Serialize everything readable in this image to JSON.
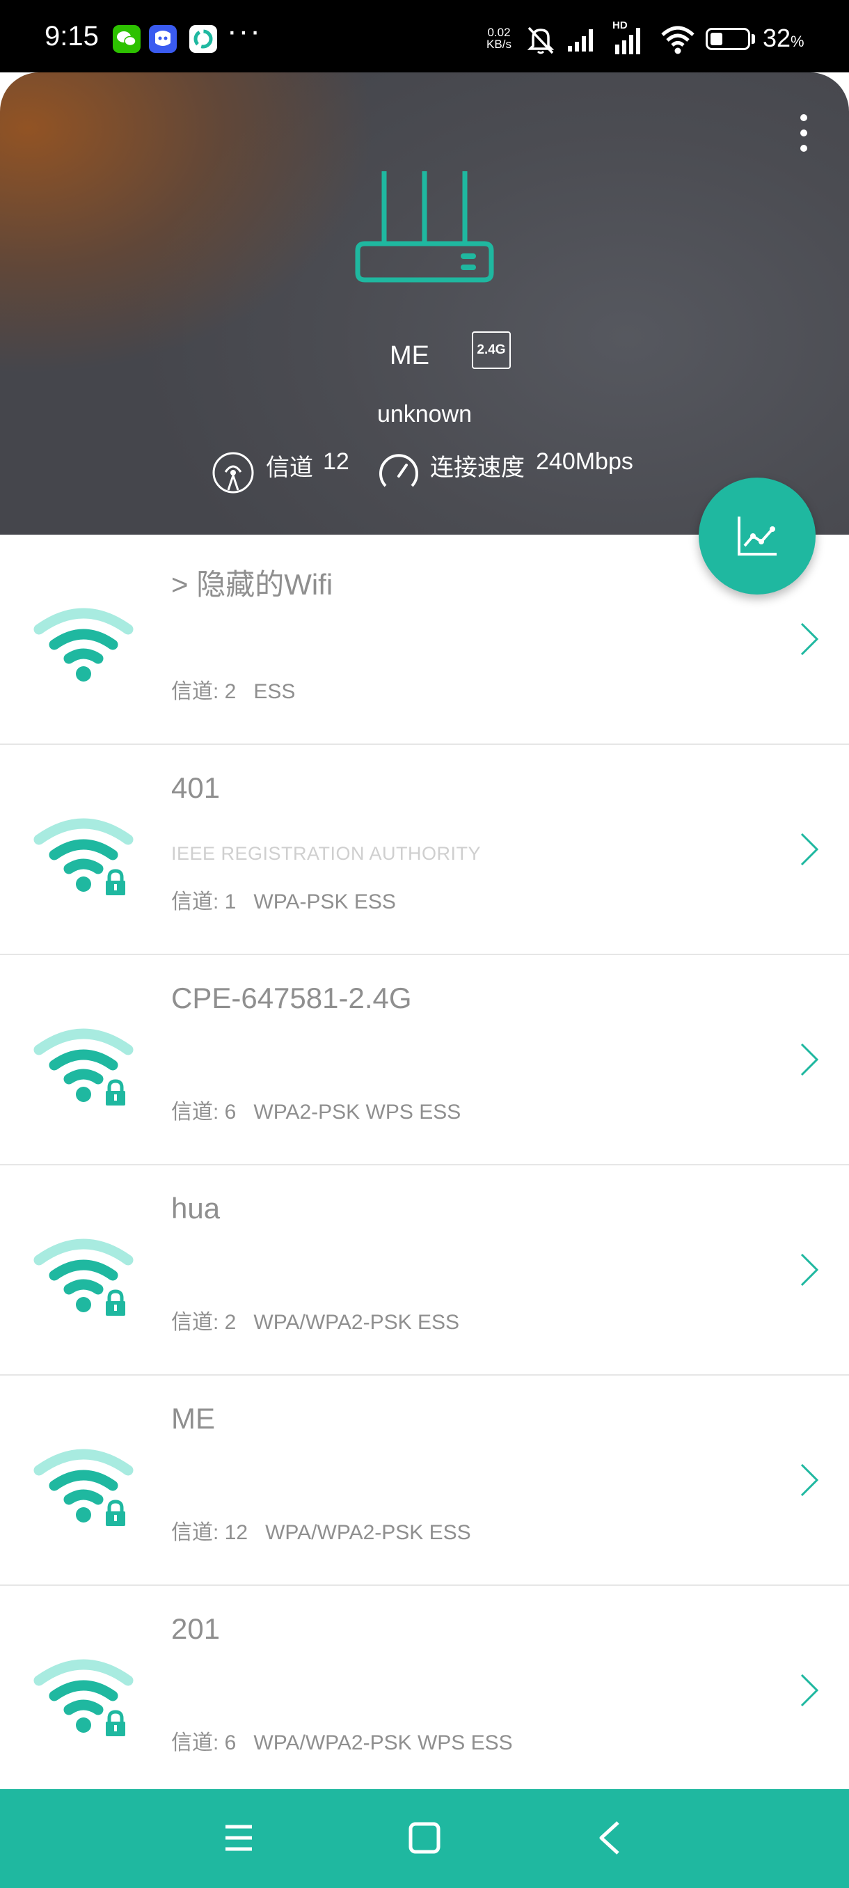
{
  "status_bar": {
    "time": "9:15",
    "net_speed_value": "0.02",
    "net_speed_unit": "KB/s",
    "hd_label": "HD",
    "battery_percent": "32",
    "battery_unit": "%",
    "battery_level": 0.32,
    "overflow": "···"
  },
  "header": {
    "ssid": "ME",
    "band": "2.4G",
    "vendor": "unknown",
    "channel_label": "信道",
    "channel_value": "12",
    "speed_label": "连接速度",
    "speed_value": "240Mbps"
  },
  "colors": {
    "accent": "#1fb8a0",
    "wifi_light": "#a8ebe0",
    "text_gray": "#8f8f8f"
  },
  "networks": [
    {
      "ssid": "> 隐藏的Wifi",
      "vendor": "",
      "channel": "信道: 2",
      "security": "ESS",
      "locked": false
    },
    {
      "ssid": "401",
      "vendor": "IEEE REGISTRATION AUTHORITY",
      "channel": "信道: 1",
      "security": "WPA-PSK ESS",
      "locked": true
    },
    {
      "ssid": "CPE-647581-2.4G",
      "vendor": "",
      "channel": "信道: 6",
      "security": "WPA2-PSK WPS ESS",
      "locked": true
    },
    {
      "ssid": "hua",
      "vendor": "",
      "channel": "信道: 2",
      "security": "WPA/WPA2-PSK ESS",
      "locked": true
    },
    {
      "ssid": "ME",
      "vendor": "",
      "channel": "信道: 12",
      "security": "WPA/WPA2-PSK ESS",
      "locked": true
    },
    {
      "ssid": "201",
      "vendor": "",
      "channel": "信道: 6",
      "security": "WPA/WPA2-PSK WPS ESS",
      "locked": true
    }
  ],
  "nav": {
    "menu_icon": "menu-icon",
    "home_icon": "home-icon",
    "back_icon": "back-icon"
  }
}
